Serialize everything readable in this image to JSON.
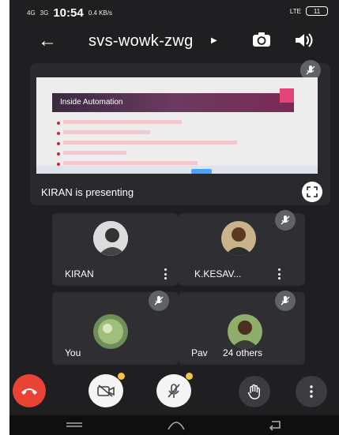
{
  "status_bar": {
    "network": "4G",
    "signal": "3G",
    "time": "10:54",
    "speed": "0.4 KB/s",
    "lte": "LTE",
    "battery": "11"
  },
  "header": {
    "meeting_code": "svs-wowk-zwg"
  },
  "presentation": {
    "slide_title": "Inside Automation",
    "presenter_text": "KIRAN is presenting"
  },
  "participants": [
    {
      "name": "KIRAN"
    },
    {
      "name": "K.KESAV..."
    },
    {
      "name": "You"
    },
    {
      "name": "Pav"
    }
  ],
  "others_count": "24 others",
  "colors": {
    "background": "#1f1f22",
    "tile": "#2e2e33",
    "end_call": "#ea4335",
    "speaking": "#1a73e8",
    "badge": "#f6c343"
  },
  "icons": [
    "back-arrow-icon",
    "camera-switch-icon",
    "speaker-icon",
    "mic-off-icon",
    "fullscreen-icon",
    "end-call-icon",
    "camera-off-icon",
    "mic-muted-icon",
    "raise-hand-icon",
    "more-options-icon"
  ]
}
